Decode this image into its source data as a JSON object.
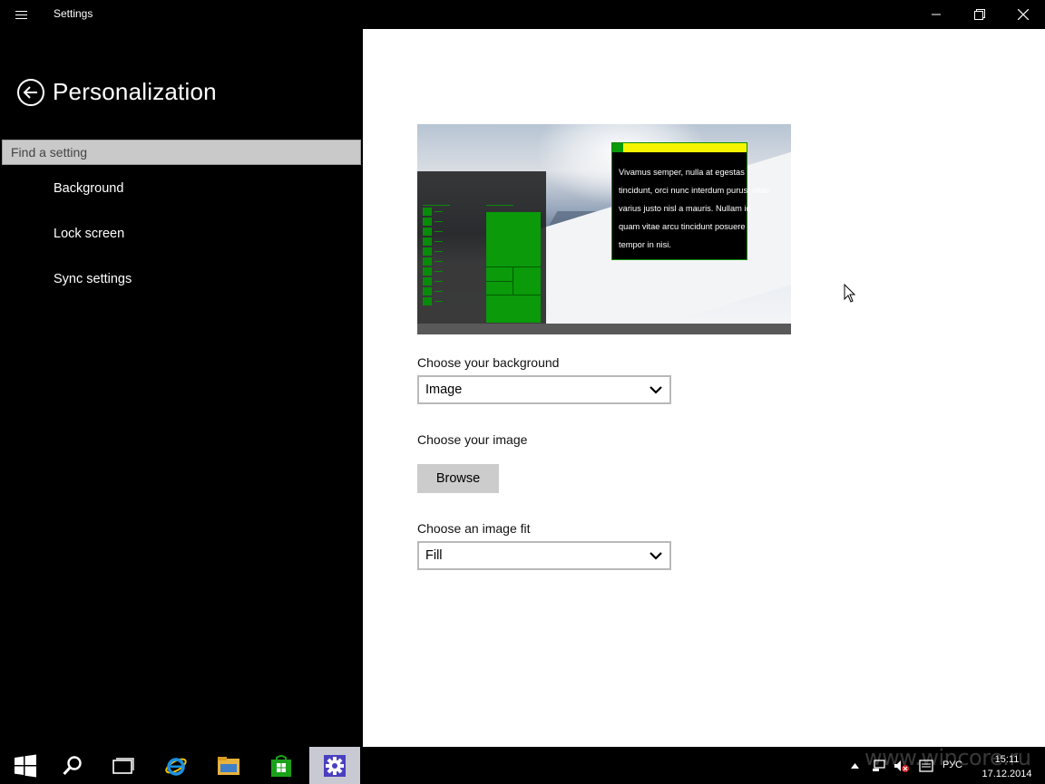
{
  "window": {
    "title": "Settings"
  },
  "sidebar": {
    "title": "Personalization",
    "search_placeholder": "Find a setting",
    "items": [
      {
        "label": "Background"
      },
      {
        "label": "Lock screen"
      },
      {
        "label": "Sync settings"
      }
    ]
  },
  "main": {
    "preview": {
      "sample_text": "Vivamus semper, nulla at egestas tincidunt, orci nunc interdum purus, vitae varius justo nisl a mauris. Nullam id quam vitae arcu tincidunt posuere tempor in nisi."
    },
    "background": {
      "label": "Choose your background",
      "value": "Image"
    },
    "image": {
      "label": "Choose your image",
      "browse_label": "Browse"
    },
    "fit": {
      "label": "Choose an image fit",
      "value": "Fill"
    }
  },
  "taskbar": {
    "icons": [
      "windows-start-icon",
      "search-icon",
      "task-view-icon",
      "internet-explorer-icon",
      "file-explorer-icon",
      "store-icon",
      "settings-icon"
    ],
    "active": "settings-icon",
    "language": "РУС",
    "time": "15:11",
    "date": "17.12.2014"
  },
  "watermark": "www.wincore.ru",
  "colors": {
    "accent": "#0a9a0a",
    "sample_titlebar": "#f5f500"
  }
}
